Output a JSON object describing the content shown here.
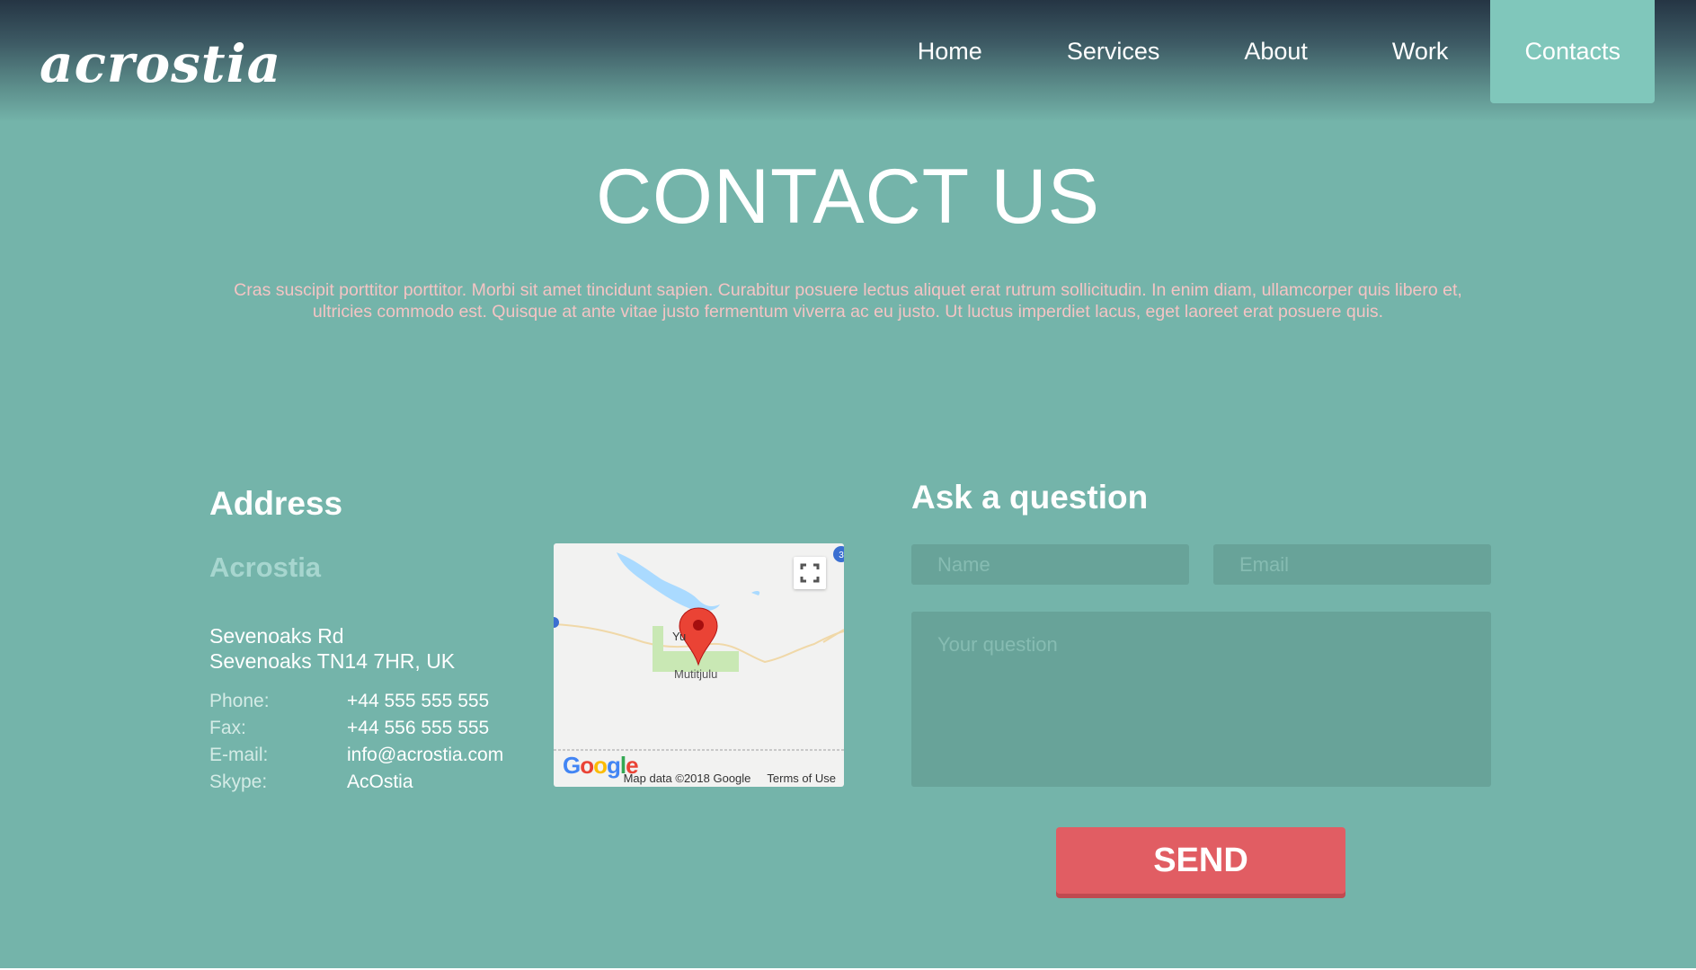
{
  "header": {
    "logo": "acrostia",
    "nav": [
      {
        "label": "Home",
        "active": false
      },
      {
        "label": "Services",
        "active": false
      },
      {
        "label": "About",
        "active": false
      },
      {
        "label": "Work",
        "active": false
      },
      {
        "label": "Contacts",
        "active": true
      }
    ]
  },
  "hero": {
    "title": "CONTACT US",
    "text": "Cras suscipit porttitor porttitor. Morbi sit amet tincidunt sapien. Curabitur posuere lectus aliquet erat rutrum sollicitudin. In enim diam, ullamcorper quis libero et, ultricies commodo est. Quisque at ante vitae justo fermentum viverra ac eu justo. Ut luctus imperdiet lacus, eget laoreet erat posuere quis."
  },
  "address": {
    "heading": "Address",
    "company": "Acrostia",
    "street_line1": "Sevenoaks Rd",
    "street_line2": "Sevenoaks TN14 7HR, UK",
    "contacts": [
      {
        "label": "Phone:",
        "value": "+44 555 555 555"
      },
      {
        "label": "Fax:",
        "value": "+44 556 555 555"
      },
      {
        "label": "E-mail:",
        "value": "info@acrostia.com"
      },
      {
        "label": "Skype:",
        "value": "AcOstia"
      }
    ]
  },
  "map": {
    "place_label": "Mutitjulu",
    "place_label_partial": "Yu",
    "google_logo": "Google",
    "attribution": "Map data ©2018 Google",
    "terms": "Terms of Use",
    "route_badge": "3",
    "pin_color": "#ea4335",
    "water_color": "#aadaff",
    "park_color": "#c9e8b4",
    "icons": [
      "fullscreen-icon",
      "map-pin-icon"
    ]
  },
  "form": {
    "heading": "Ask a question",
    "name_placeholder": "Name",
    "email_placeholder": "Email",
    "question_placeholder": "Your question",
    "send_label": "SEND"
  },
  "colors": {
    "background": "#74b4aa",
    "header_dark": "#253544",
    "nav_active": "#80c7bb",
    "input_bg": "#68a399",
    "send_button": "#e15d63",
    "hero_text": "#f4c4c4",
    "company_name": "#a7d6cf"
  }
}
